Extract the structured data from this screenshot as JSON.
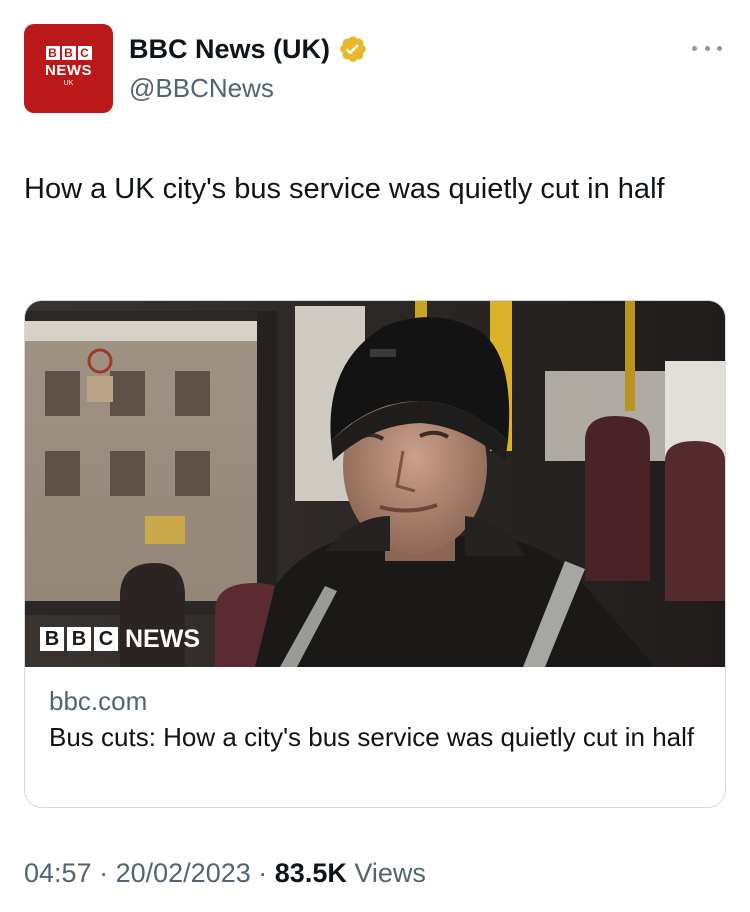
{
  "author": {
    "avatar": {
      "blocks": [
        "B",
        "B",
        "C"
      ],
      "news_text": "NEWS",
      "region_text": "UK",
      "background_color": "#bb1919"
    },
    "display_name": "BBC News (UK)",
    "verified_badge_color": "#e8b829",
    "handle": "@BBCNews",
    "more_icon": "more-horizontal-icon"
  },
  "tweet": {
    "text": "How a UK city's bus service was quietly cut in half"
  },
  "card": {
    "image_watermark": {
      "blocks": [
        "B",
        "B",
        "C"
      ],
      "news_text": "NEWS"
    },
    "domain": "bbc.com",
    "title": "Bus cuts: How a city's bus service was quietly cut in half"
  },
  "meta": {
    "time": "04:57",
    "separator": "·",
    "date": "20/02/2023",
    "views_count": "83.5K",
    "views_label": "Views"
  }
}
